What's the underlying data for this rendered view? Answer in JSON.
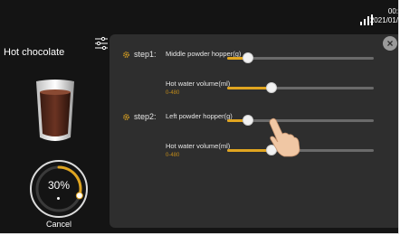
{
  "status": {
    "time": "00:",
    "date": "2021/01/"
  },
  "drink": {
    "name": "Hot chocolate"
  },
  "progress": {
    "percent_label": "30%",
    "fraction": 0.3
  },
  "cancel_label": "Cancel",
  "steps": [
    {
      "label": "step1:",
      "rows": [
        {
          "label": "Middle powder hopper(g)",
          "range": "",
          "fraction": 0.14
        },
        {
          "label": "Hot water volume(ml)",
          "range": "0-480",
          "fraction": 0.3
        }
      ]
    },
    {
      "label": "step2:",
      "rows": [
        {
          "label": "Left powder hopper(g)",
          "range": "",
          "fraction": 0.14
        },
        {
          "label": "Hot water volume(ml)",
          "range": "0-480",
          "fraction": 0.3
        }
      ]
    }
  ],
  "colors": {
    "accent": "#e0a520",
    "panel": "#2e2e2e",
    "background": "#141414"
  },
  "icons": [
    "signal-icon",
    "settings-icon",
    "cup-icon",
    "close-icon",
    "gear-icon",
    "hand-pointer-icon"
  ]
}
